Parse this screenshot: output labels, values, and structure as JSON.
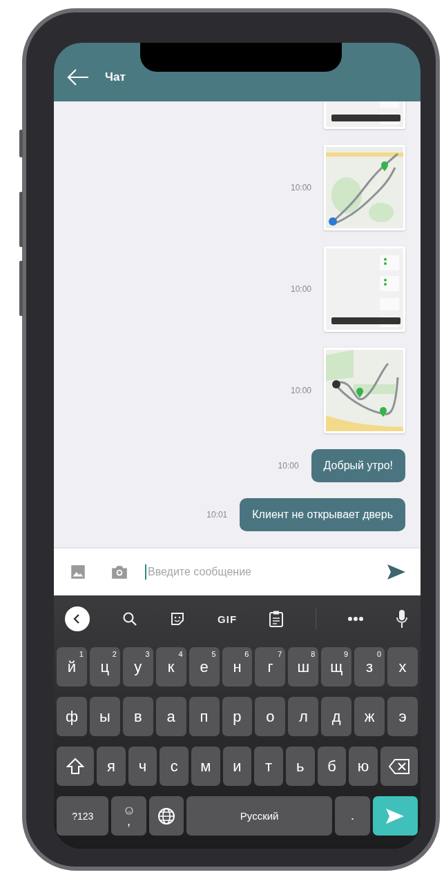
{
  "header": {
    "title": "Чат"
  },
  "messages": [
    {
      "kind": "screenshot"
    },
    {
      "kind": "map",
      "time": "10:00"
    },
    {
      "kind": "screenshot",
      "time": "10:00"
    },
    {
      "kind": "map",
      "time": "10:00"
    },
    {
      "kind": "text",
      "text": "Добрый утро!",
      "time": "10:00"
    },
    {
      "kind": "text",
      "text": "Клиент не открывает дверь",
      "time": "10:01"
    }
  ],
  "composer": {
    "placeholder": "Введите сообщение"
  },
  "keyboard": {
    "toolbar": [
      {
        "kind": "collapse"
      },
      {
        "kind": "search"
      },
      {
        "kind": "sticker"
      },
      {
        "kind": "gif",
        "label": "GIF"
      },
      {
        "kind": "clipboard"
      },
      {
        "kind": "more"
      },
      {
        "kind": "mic"
      }
    ],
    "rows": [
      [
        {
          "kind": "letter",
          "label": "й",
          "hint": "1"
        },
        {
          "kind": "letter",
          "label": "ц",
          "hint": "2"
        },
        {
          "kind": "letter",
          "label": "у",
          "hint": "3"
        },
        {
          "kind": "letter",
          "label": "к",
          "hint": "4"
        },
        {
          "kind": "letter",
          "label": "е",
          "hint": "5"
        },
        {
          "kind": "letter",
          "label": "н",
          "hint": "6"
        },
        {
          "kind": "letter",
          "label": "г",
          "hint": "7"
        },
        {
          "kind": "letter",
          "label": "ш",
          "hint": "8"
        },
        {
          "kind": "letter",
          "label": "щ",
          "hint": "9"
        },
        {
          "kind": "letter",
          "label": "з",
          "hint": "0"
        },
        {
          "kind": "letter",
          "label": "х"
        }
      ],
      [
        {
          "kind": "letter",
          "label": "ф"
        },
        {
          "kind": "letter",
          "label": "ы"
        },
        {
          "kind": "letter",
          "label": "в"
        },
        {
          "kind": "letter",
          "label": "а"
        },
        {
          "kind": "letter",
          "label": "п"
        },
        {
          "kind": "letter",
          "label": "р"
        },
        {
          "kind": "letter",
          "label": "о"
        },
        {
          "kind": "letter",
          "label": "л"
        },
        {
          "kind": "letter",
          "label": "д"
        },
        {
          "kind": "letter",
          "label": "ж"
        },
        {
          "kind": "letter",
          "label": "э"
        }
      ],
      [
        {
          "kind": "shift"
        },
        {
          "kind": "letter",
          "label": "я"
        },
        {
          "kind": "letter",
          "label": "ч"
        },
        {
          "kind": "letter",
          "label": "с"
        },
        {
          "kind": "letter",
          "label": "м"
        },
        {
          "kind": "letter",
          "label": "и"
        },
        {
          "kind": "letter",
          "label": "т"
        },
        {
          "kind": "letter",
          "label": "ь"
        },
        {
          "kind": "letter",
          "label": "б"
        },
        {
          "kind": "letter",
          "label": "ю"
        },
        {
          "kind": "backspace"
        }
      ]
    ],
    "bottom_bar": [
      {
        "kind": "symbols",
        "label": "?123"
      },
      {
        "kind": "comma",
        "label": ","
      },
      {
        "kind": "globe"
      },
      {
        "kind": "space",
        "label": "Русский"
      },
      {
        "kind": "period",
        "label": "."
      },
      {
        "kind": "enter"
      }
    ]
  }
}
